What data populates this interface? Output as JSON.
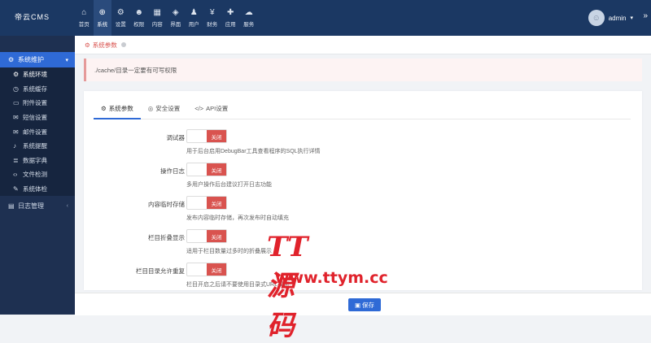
{
  "app": {
    "brand": "帝云CMS"
  },
  "nav": [
    {
      "icon": "home-icon",
      "glyph": "⌂",
      "label": "首页"
    },
    {
      "icon": "globe-icon",
      "glyph": "⊕",
      "label": "系统",
      "active": true
    },
    {
      "icon": "cogs-icon",
      "glyph": "⚙",
      "label": "设置"
    },
    {
      "icon": "user-circle-icon",
      "glyph": "☻",
      "label": "权限"
    },
    {
      "icon": "grid-icon",
      "glyph": "▦",
      "label": "内容"
    },
    {
      "icon": "html5-icon",
      "glyph": "◈",
      "label": "界面"
    },
    {
      "icon": "user-icon",
      "glyph": "♟",
      "label": "用户"
    },
    {
      "icon": "yen-icon",
      "glyph": "¥",
      "label": "财务"
    },
    {
      "icon": "puzzle-icon",
      "glyph": "✚",
      "label": "应用"
    },
    {
      "icon": "cloud-icon",
      "glyph": "☁",
      "label": "服务"
    }
  ],
  "user": {
    "name": "admin"
  },
  "sidebar": {
    "section": "系统维护",
    "items": [
      {
        "icon": "gear-icon",
        "glyph": "⚙",
        "label": "系统环境"
      },
      {
        "icon": "clock-icon",
        "glyph": "◷",
        "label": "系统缓存"
      },
      {
        "icon": "folder-icon",
        "glyph": "▭",
        "label": "附件设置"
      },
      {
        "icon": "envelope-icon",
        "glyph": "✉",
        "label": "短信设置"
      },
      {
        "icon": "envelope-open-icon",
        "glyph": "✉",
        "label": "邮件设置"
      },
      {
        "icon": "bell-icon",
        "glyph": "♪",
        "label": "系统提醒"
      },
      {
        "icon": "database-icon",
        "glyph": "≣",
        "label": "数据字典"
      },
      {
        "icon": "code-icon",
        "glyph": "‹›",
        "label": "文件检测"
      },
      {
        "icon": "wrench-icon",
        "glyph": "✎",
        "label": "系统体检"
      }
    ],
    "second": {
      "icon": "calendar-icon",
      "glyph": "▤",
      "label": "日志管理"
    }
  },
  "breadcrumb": {
    "label": "系统参数"
  },
  "alert": {
    "text": "./cache/目录一定要有可写权限"
  },
  "tabs": [
    {
      "icon": "cog-icon",
      "glyph": "⚙",
      "label": "系统参数",
      "active": true
    },
    {
      "icon": "shield-icon",
      "glyph": "◎",
      "label": "安全设置"
    },
    {
      "icon": "code-icon",
      "glyph": "</>",
      "label": "API设置"
    }
  ],
  "settings": [
    {
      "label": "调试器",
      "state": "关闭",
      "help": "用于后台启用DebugBar工具查看程序的SQL执行详情"
    },
    {
      "label": "操作日志",
      "state": "关闭",
      "help": "多用户操作后台建议打开日志功能"
    },
    {
      "label": "内容临时存储",
      "state": "关闭",
      "help": "发布内容临时存储，再次发布时自动填充"
    },
    {
      "label": "栏目折叠显示",
      "state": "关闭",
      "help": "适用于栏目数量过多时的折叠展示"
    },
    {
      "label": "栏目目录允许重复",
      "state": "关闭",
      "help": "栏目开启之后请不要使用目录式URL规则"
    }
  ],
  "footer": {
    "save_label": "保存"
  },
  "watermark": {
    "logo": "TT源码",
    "url": "www.ttym.cc"
  }
}
